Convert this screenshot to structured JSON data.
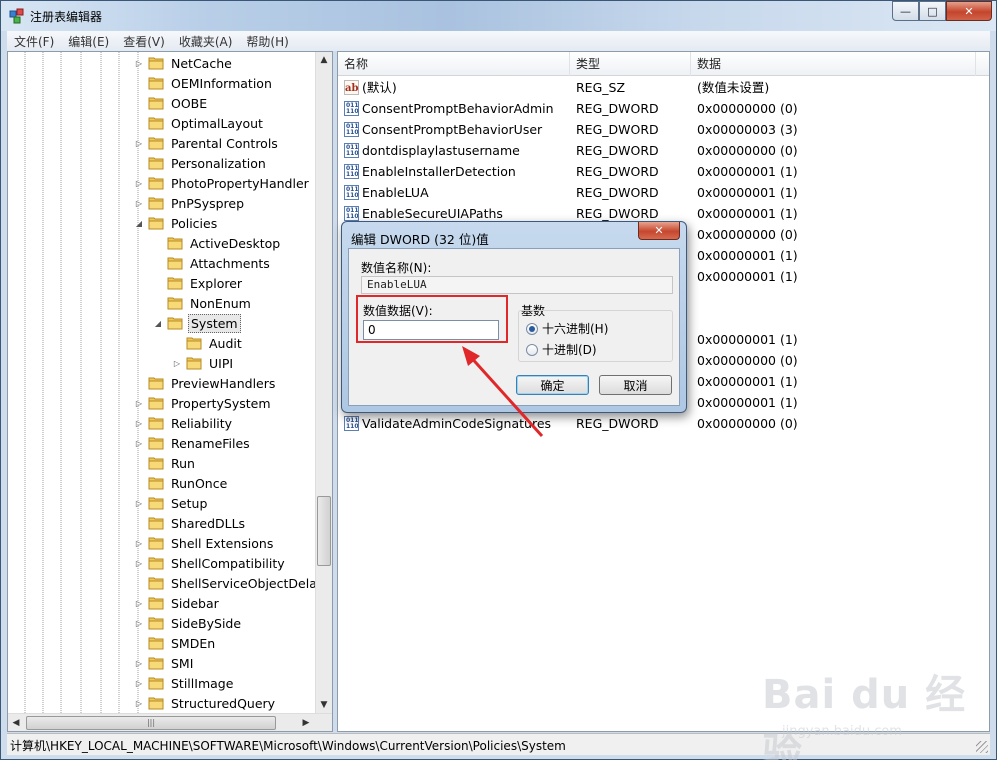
{
  "window": {
    "title": "注册表编辑器",
    "min": "—",
    "max": "□",
    "close": "✕"
  },
  "menu": [
    "文件(F)",
    "编辑(E)",
    "查看(V)",
    "收藏夹(A)",
    "帮助(H)"
  ],
  "tree": [
    {
      "label": "NetCache",
      "expander": "▷",
      "indent": 0
    },
    {
      "label": "OEMInformation",
      "expander": "",
      "indent": 0
    },
    {
      "label": "OOBE",
      "expander": "",
      "indent": 0
    },
    {
      "label": "OptimalLayout",
      "expander": "",
      "indent": 0
    },
    {
      "label": "Parental Controls",
      "expander": "▷",
      "indent": 0
    },
    {
      "label": "Personalization",
      "expander": "",
      "indent": 0
    },
    {
      "label": "PhotoPropertyHandler",
      "expander": "▷",
      "indent": 0
    },
    {
      "label": "PnPSysprep",
      "expander": "▷",
      "indent": 0
    },
    {
      "label": "Policies",
      "expander": "◢",
      "indent": 0
    },
    {
      "label": "ActiveDesktop",
      "expander": "",
      "indent": 1
    },
    {
      "label": "Attachments",
      "expander": "",
      "indent": 1
    },
    {
      "label": "Explorer",
      "expander": "",
      "indent": 1
    },
    {
      "label": "NonEnum",
      "expander": "",
      "indent": 1
    },
    {
      "label": "System",
      "expander": "◢",
      "indent": 1,
      "selected": true
    },
    {
      "label": "Audit",
      "expander": "",
      "indent": 2
    },
    {
      "label": "UIPI",
      "expander": "▷",
      "indent": 2
    },
    {
      "label": "PreviewHandlers",
      "expander": "",
      "indent": 0
    },
    {
      "label": "PropertySystem",
      "expander": "▷",
      "indent": 0
    },
    {
      "label": "Reliability",
      "expander": "▷",
      "indent": 0
    },
    {
      "label": "RenameFiles",
      "expander": "▷",
      "indent": 0
    },
    {
      "label": "Run",
      "expander": "",
      "indent": 0
    },
    {
      "label": "RunOnce",
      "expander": "",
      "indent": 0
    },
    {
      "label": "Setup",
      "expander": "▷",
      "indent": 0
    },
    {
      "label": "SharedDLLs",
      "expander": "",
      "indent": 0
    },
    {
      "label": "Shell Extensions",
      "expander": "▷",
      "indent": 0
    },
    {
      "label": "ShellCompatibility",
      "expander": "▷",
      "indent": 0
    },
    {
      "label": "ShellServiceObjectDelayLoad",
      "expander": "",
      "indent": 0
    },
    {
      "label": "Sidebar",
      "expander": "▷",
      "indent": 0
    },
    {
      "label": "SideBySide",
      "expander": "▷",
      "indent": 0
    },
    {
      "label": "SMDEn",
      "expander": "",
      "indent": 0
    },
    {
      "label": "SMI",
      "expander": "▷",
      "indent": 0
    },
    {
      "label": "StillImage",
      "expander": "▷",
      "indent": 0
    },
    {
      "label": "StructuredQuery",
      "expander": "▷",
      "indent": 0
    }
  ],
  "columns": {
    "name": "名称",
    "type": "类型",
    "data": "数据"
  },
  "values": [
    {
      "name": "(默认)",
      "type": "REG_SZ",
      "data": "(数值未设置)",
      "icon": "str"
    },
    {
      "name": "ConsentPromptBehaviorAdmin",
      "type": "REG_DWORD",
      "data": "0x00000000 (0)",
      "icon": "bin"
    },
    {
      "name": "ConsentPromptBehaviorUser",
      "type": "REG_DWORD",
      "data": "0x00000003 (3)",
      "icon": "bin"
    },
    {
      "name": "dontdisplaylastusername",
      "type": "REG_DWORD",
      "data": "0x00000000 (0)",
      "icon": "bin"
    },
    {
      "name": "EnableInstallerDetection",
      "type": "REG_DWORD",
      "data": "0x00000001 (1)",
      "icon": "bin"
    },
    {
      "name": "EnableLUA",
      "type": "REG_DWORD",
      "data": "0x00000001 (1)",
      "icon": "bin"
    },
    {
      "name": "EnableSecureUIAPaths",
      "type": "REG_DWORD",
      "data": "0x00000001 (1)",
      "icon": "bin"
    },
    {
      "name": "",
      "type": "",
      "data": "0x00000000 (0)",
      "icon": ""
    },
    {
      "name": "",
      "type": "",
      "data": "0x00000001 (1)",
      "icon": ""
    },
    {
      "name": "",
      "type": "",
      "data": "0x00000001 (1)",
      "icon": ""
    },
    {
      "name": "",
      "type": "",
      "data": "",
      "icon": ""
    },
    {
      "name": "",
      "type": "",
      "data": "",
      "icon": ""
    },
    {
      "name": "",
      "type": "",
      "data": "0x00000001 (1)",
      "icon": ""
    },
    {
      "name": "",
      "type": "",
      "data": "0x00000000 (0)",
      "icon": ""
    },
    {
      "name": "",
      "type": "",
      "data": "0x00000001 (1)",
      "icon": ""
    },
    {
      "name": "",
      "type": "",
      "data": "0x00000001 (1)",
      "icon": ""
    },
    {
      "name": "ValidateAdminCodeSignatures",
      "type": "REG_DWORD",
      "data": "0x00000000 (0)",
      "icon": "bin"
    }
  ],
  "status": {
    "path": "计算机\\HKEY_LOCAL_MACHINE\\SOFTWARE\\Microsoft\\Windows\\CurrentVersion\\Policies\\System"
  },
  "dialog": {
    "title": "编辑 DWORD (32 位)值",
    "close": "✕",
    "name_label": "数值名称(N):",
    "name_value": "EnableLUA",
    "data_label": "数值数据(V):",
    "data_value": "0",
    "radix_label": "基数",
    "hex_label": "十六进制(H)",
    "dec_label": "十进制(D)",
    "ok": "确定",
    "cancel": "取消"
  },
  "watermark": {
    "brand": "Bai du 经验",
    "sub": "jingyan.baidu.com"
  },
  "colors": {
    "annotation": "#e0282a",
    "folder": "#f2c75a"
  }
}
